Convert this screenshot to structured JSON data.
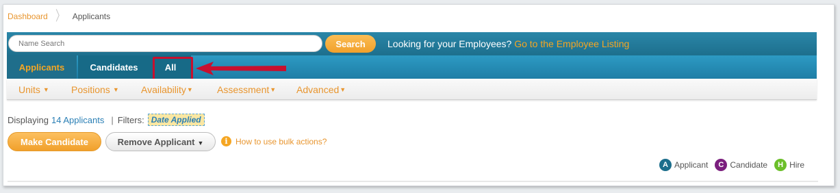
{
  "breadcrumb": {
    "home": "Dashboard",
    "current": "Applicants"
  },
  "search": {
    "placeholder": "Name Search",
    "button": "Search",
    "prompt": "Looking for your Employees?",
    "link": "Go to the Employee Listing"
  },
  "tabs": [
    {
      "label": "Applicants",
      "active": true
    },
    {
      "label": "Candidates",
      "active": false
    },
    {
      "label": "All",
      "active": false,
      "highlighted": true
    }
  ],
  "filters": [
    {
      "label": "Units"
    },
    {
      "label": "Positions"
    },
    {
      "label": "Availability"
    },
    {
      "label": "Assessment"
    },
    {
      "label": "Advanced"
    }
  ],
  "summary": {
    "prefix": "Displaying",
    "count": "14 Applicants",
    "separator": "|",
    "filters_label": "Filters:",
    "filter_tag": "Date Applied"
  },
  "actions": {
    "make_candidate": "Make Candidate",
    "remove_applicant": "Remove Applicant",
    "help_link": "How to use bulk actions?"
  },
  "legend": [
    {
      "letter": "A",
      "label": "Applicant",
      "color": "#1c6e8c"
    },
    {
      "letter": "C",
      "label": "Candidate",
      "color": "#7b1f7e"
    },
    {
      "letter": "H",
      "label": "Hire",
      "color": "#6cbf2a"
    }
  ],
  "colors": {
    "accent_orange": "#f5a623",
    "header_blue": "#1d6f8d",
    "annotation_red": "#c8102e"
  }
}
